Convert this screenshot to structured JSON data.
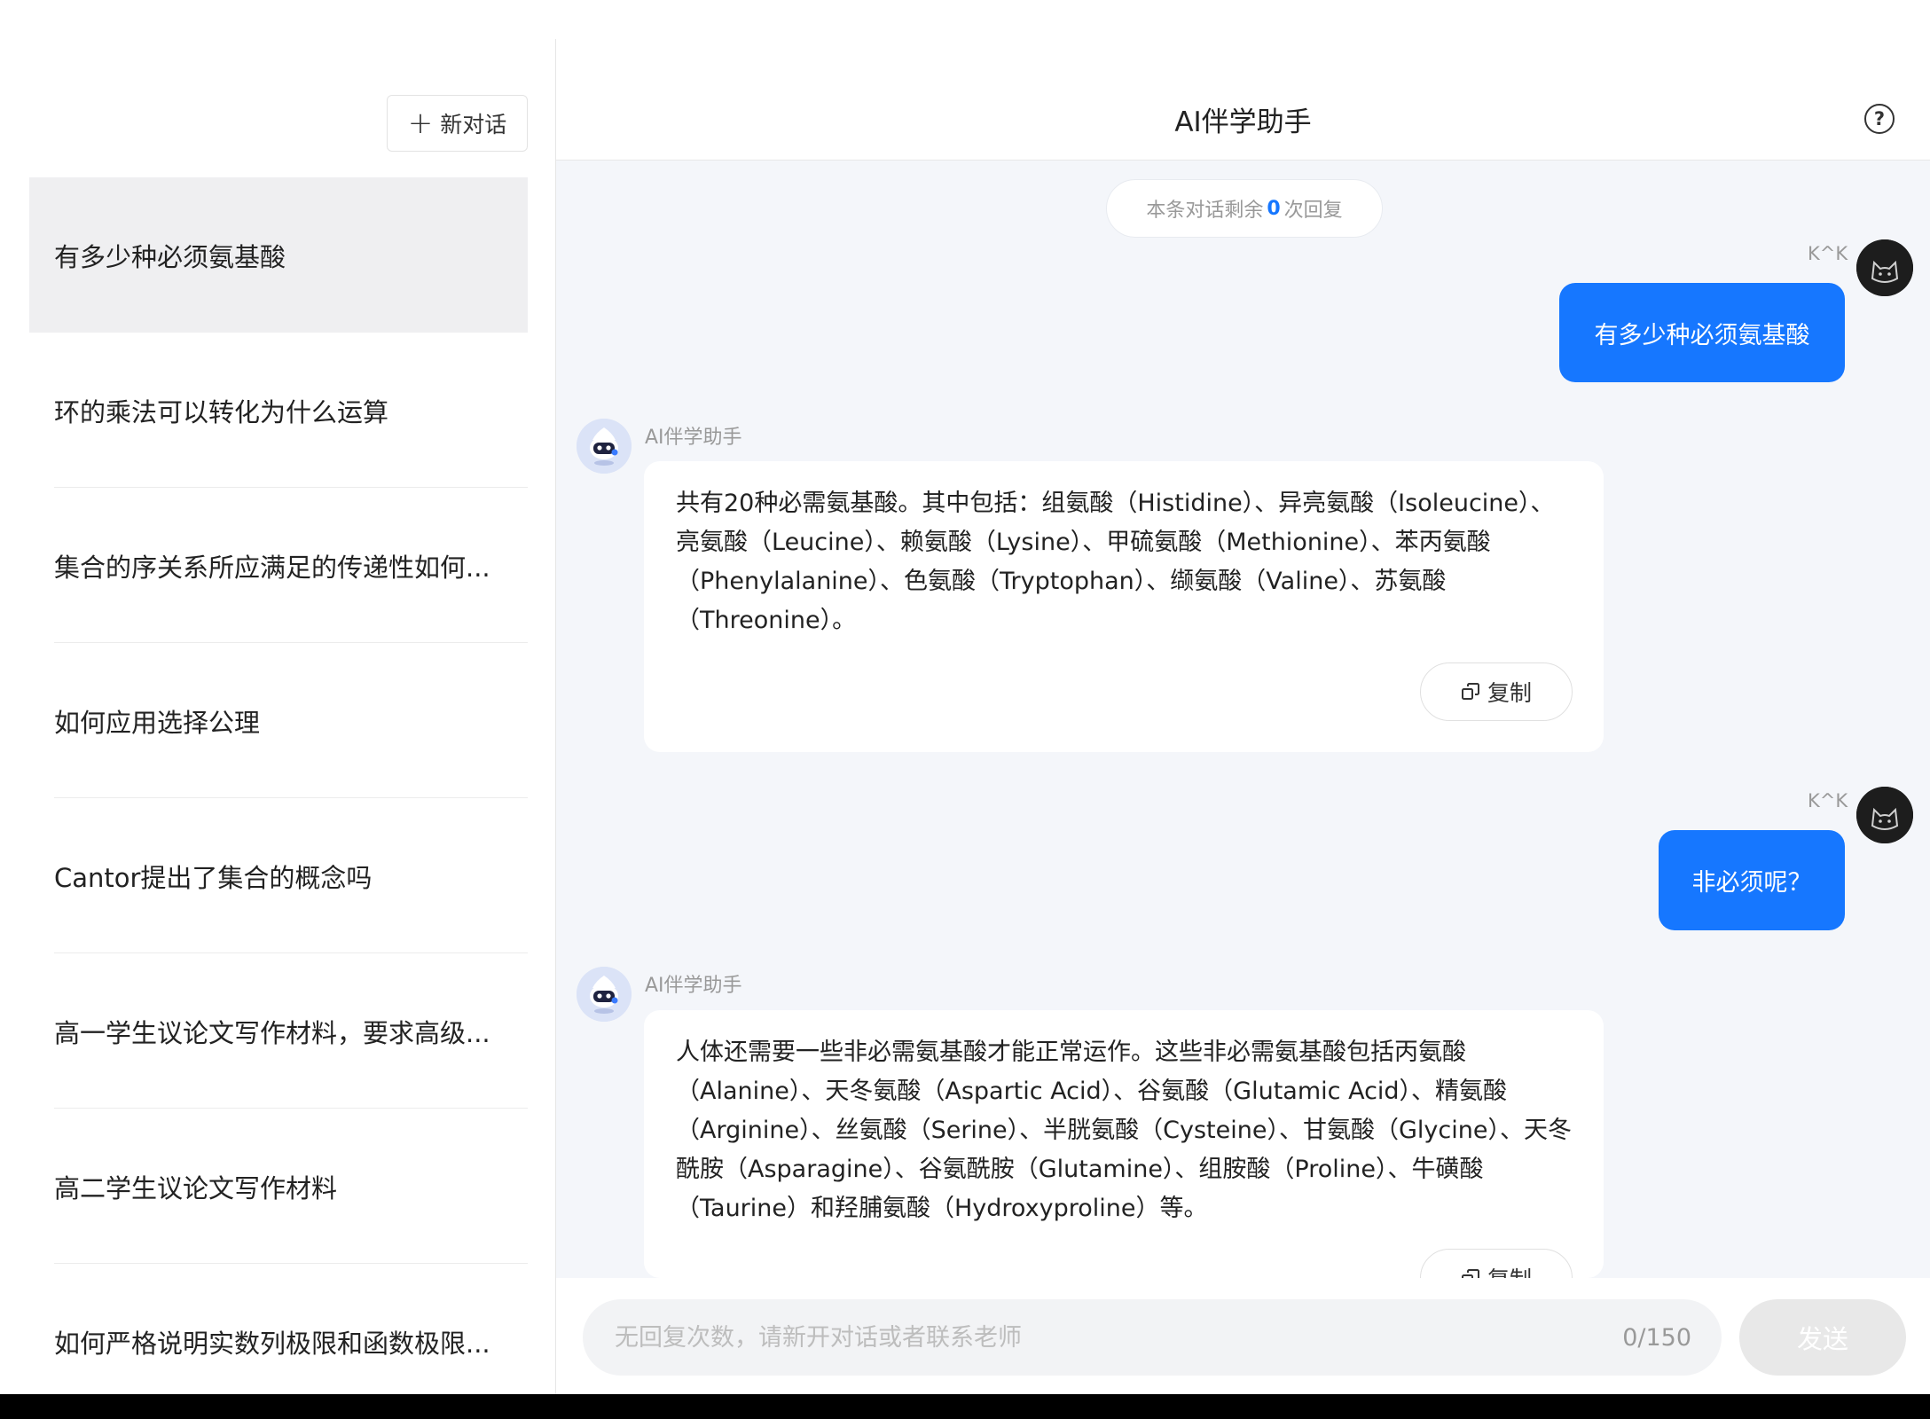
{
  "sidebar": {
    "new_chat_label": "新对话",
    "conversations": [
      {
        "title": "有多少种必须氨基酸"
      },
      {
        "title": "环的乘法可以转化为什么运算"
      },
      {
        "title": "集合的序关系所应满足的传递性如何..."
      },
      {
        "title": "如何应用选择公理"
      },
      {
        "title": "Cantor提出了集合的概念吗"
      },
      {
        "title": "高一学生议论文写作材料，要求高级..."
      },
      {
        "title": "高二学生议论文写作材料"
      },
      {
        "title": "如何严格说明实数列极限和函数极限..."
      }
    ]
  },
  "header": {
    "title": "AI伴学助手",
    "help_symbol": "?"
  },
  "chat": {
    "remaining": {
      "prefix": "本条对话剩余",
      "count": "0",
      "suffix": "次回复"
    },
    "messages": [
      {
        "role": "user",
        "name": "K^K",
        "text": "有多少种必须氨基酸"
      },
      {
        "role": "ai",
        "name": "AI伴学助手",
        "text": "共有20种必需氨基酸。其中包括：组氨酸（Histidine）、异亮氨酸（Isoleucine）、亮氨酸（Leucine）、赖氨酸（Lysine）、甲硫氨酸（Methionine）、苯丙氨酸（Phenylalanine）、色氨酸（Tryptophan）、缬氨酸（Valine）、苏氨酸（Threonine）。",
        "copy_label": "复制"
      },
      {
        "role": "user",
        "name": "K^K",
        "text": "非必须呢？"
      },
      {
        "role": "ai",
        "name": "AI伴学助手",
        "text": "人体还需要一些非必需氨基酸才能正常运作。这些非必需氨基酸包括丙氨酸（Alanine）、天冬氨酸（Aspartic Acid）、谷氨酸（Glutamic Acid）、精氨酸（Arginine）、丝氨酸（Serine）、半胱氨酸（Cysteine）、甘氨酸（Glycine）、天冬酰胺（Asparagine）、谷氨酰胺（Glutamine）、组胺酸（Proline）、牛磺酸（Taurine）和羟脯氨酸（Hydroxyproline）等。",
        "copy_label": "复制"
      }
    ]
  },
  "input": {
    "placeholder": "无回复次数，请新开对话或者联系老师",
    "value": "",
    "char_count": "0/150",
    "send_label": "发送"
  },
  "colors": {
    "accent": "#1677ff",
    "active_item_bg": "#efeff1",
    "main_bg": "#f4f6fa"
  }
}
